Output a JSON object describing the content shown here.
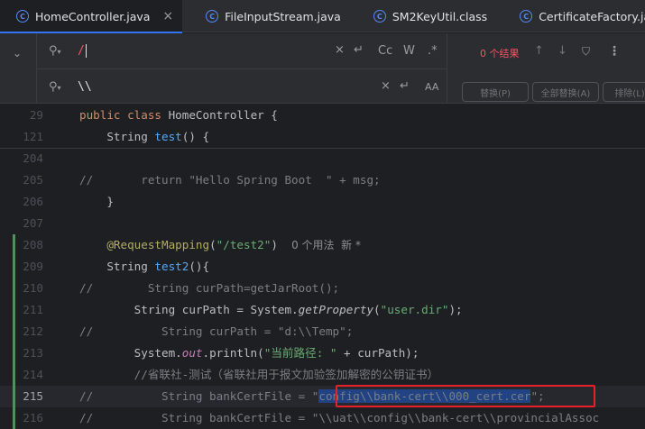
{
  "tabs": [
    {
      "label": "HomeController.java",
      "active": true,
      "closable": true
    },
    {
      "label": "FileInputStream.java",
      "active": false,
      "closable": false
    },
    {
      "label": "SM2KeyUtil.class",
      "active": false,
      "closable": false
    },
    {
      "label": "CertificateFactory.java",
      "active": false,
      "closable": false
    }
  ],
  "find": {
    "search_value": "/",
    "replace_value": "\\\\",
    "result_count": "0 个结果",
    "options": {
      "clear": "×",
      "newline": "↵",
      "match_case": "Cc",
      "words": "W",
      "regex": ".*",
      "preserve_case": "AA"
    },
    "buttons": {
      "replace": "替换(P)",
      "replace_all": "全部替换(A)",
      "exclude": "排除(L)"
    }
  },
  "editor": {
    "lines": [
      {
        "num": "29",
        "segments": [
          {
            "t": "public class ",
            "c": "kw"
          },
          {
            "t": "HomeController {",
            "c": ""
          }
        ]
      },
      {
        "num": "121",
        "segments": [
          {
            "t": "    String ",
            "c": ""
          },
          {
            "t": "test",
            "c": "fn"
          },
          {
            "t": "() {",
            "c": ""
          }
        ]
      },
      {
        "num": "204",
        "segments": []
      },
      {
        "num": "205",
        "segments": [
          {
            "t": "//       return \"Hello Spring Boot  \" + msg;",
            "c": "cm"
          }
        ]
      },
      {
        "num": "206",
        "segments": [
          {
            "t": "    }",
            "c": ""
          }
        ]
      },
      {
        "num": "207",
        "segments": []
      },
      {
        "num": "208",
        "segments": [
          {
            "t": "    @RequestMapping",
            "c": "ann"
          },
          {
            "t": "(",
            "c": ""
          },
          {
            "t": "\"/test2\"",
            "c": "str"
          },
          {
            "t": ")  ",
            "c": ""
          },
          {
            "t": "0 个用法  新 *",
            "c": "hint"
          }
        ]
      },
      {
        "num": "209",
        "segments": [
          {
            "t": "    String ",
            "c": ""
          },
          {
            "t": "test2",
            "c": "fn"
          },
          {
            "t": "(){",
            "c": ""
          }
        ]
      },
      {
        "num": "210",
        "segments": [
          {
            "t": "//        String curPath=getJarRoot();",
            "c": "cm"
          }
        ]
      },
      {
        "num": "211",
        "segments": [
          {
            "t": "        String curPath = System.",
            "c": ""
          },
          {
            "t": "getProperty",
            "c": "italic"
          },
          {
            "t": "(",
            "c": ""
          },
          {
            "t": "\"user.dir\"",
            "c": "str"
          },
          {
            "t": ");",
            "c": ""
          }
        ]
      },
      {
        "num": "212",
        "segments": [
          {
            "t": "//          String curPath = \"d:\\\\Temp\";",
            "c": "cm"
          }
        ]
      },
      {
        "num": "213",
        "segments": [
          {
            "t": "        System.",
            "c": ""
          },
          {
            "t": "out",
            "c": "static"
          },
          {
            "t": ".println(",
            "c": ""
          },
          {
            "t": "\"当前路径: \"",
            "c": "str"
          },
          {
            "t": " + curPath);",
            "c": ""
          }
        ]
      },
      {
        "num": "214",
        "segments": [
          {
            "t": "        //省联社-测试（省联社用于报文加验签加解密的公钥证书）",
            "c": "cm"
          }
        ]
      },
      {
        "num": "215",
        "current": true,
        "segments": [
          {
            "t": "//          String bankCertFile = ",
            "c": "cm"
          },
          {
            "t": "\"",
            "c": "cm"
          },
          {
            "t": "config\\\\bank-cert\\\\000_cert.cer",
            "c": "cm sel"
          },
          {
            "t": "\";",
            "c": "cm"
          }
        ]
      },
      {
        "num": "216",
        "segments": [
          {
            "t": "//          String bankCertFile = \"\\\\uat\\\\config\\\\bank-cert\\\\provincialAssoc",
            "c": "cm"
          }
        ]
      }
    ]
  },
  "colors": {
    "accent": "#3574f0",
    "highlight_box": "#e8202a",
    "vcs_added": "#549159"
  }
}
